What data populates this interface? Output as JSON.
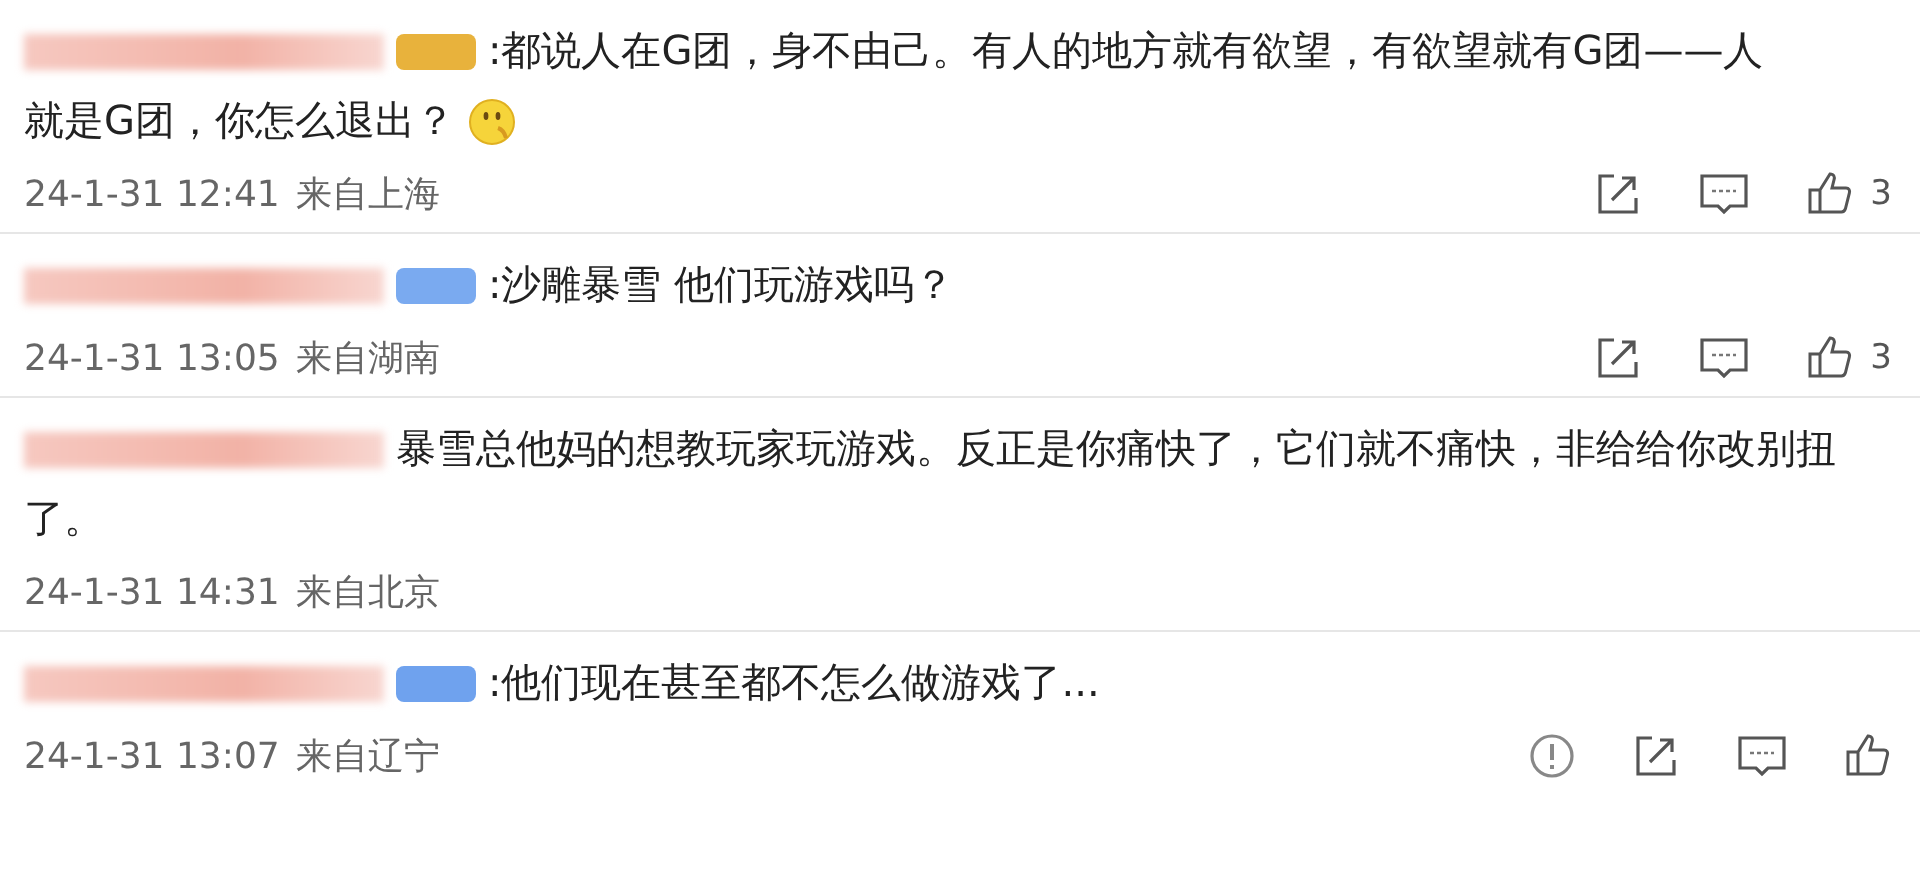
{
  "comments": [
    {
      "badge": {
        "color": "#e8b23c"
      },
      "lines": [
        ":都说人在G团，身不由己。有人的地方就有欲望，有欲望就有G团——人",
        "就是G团，你怎么退出？"
      ],
      "emoji": true,
      "time": "24-1-31 12:41",
      "location": "来自上海",
      "actions": [
        {
          "kind": "share"
        },
        {
          "kind": "comment"
        },
        {
          "kind": "like",
          "count": "3"
        }
      ]
    },
    {
      "badge": {
        "color": "#7aaaf0"
      },
      "lines": [
        ":沙雕暴雪 他们玩游戏吗？"
      ],
      "time": "24-1-31 13:05",
      "location": "来自湖南",
      "actions": [
        {
          "kind": "share"
        },
        {
          "kind": "comment"
        },
        {
          "kind": "like",
          "count": "3"
        }
      ]
    },
    {
      "lines": [
        "暴雪总他妈的想教玩家玩游戏。反正是你痛快了，它们就不痛快，非给给你改别扭",
        "了。"
      ],
      "time": "24-1-31 14:31",
      "location": "来自北京"
    },
    {
      "badge": {
        "color": "#6fa2ee"
      },
      "lines": [
        ":他们现在甚至都不怎么做游戏了..."
      ],
      "time": "24-1-31 13:07",
      "location": "来自辽宁",
      "actions": [
        {
          "kind": "report"
        },
        {
          "kind": "share"
        },
        {
          "kind": "comment"
        },
        {
          "kind": "like"
        }
      ]
    }
  ]
}
